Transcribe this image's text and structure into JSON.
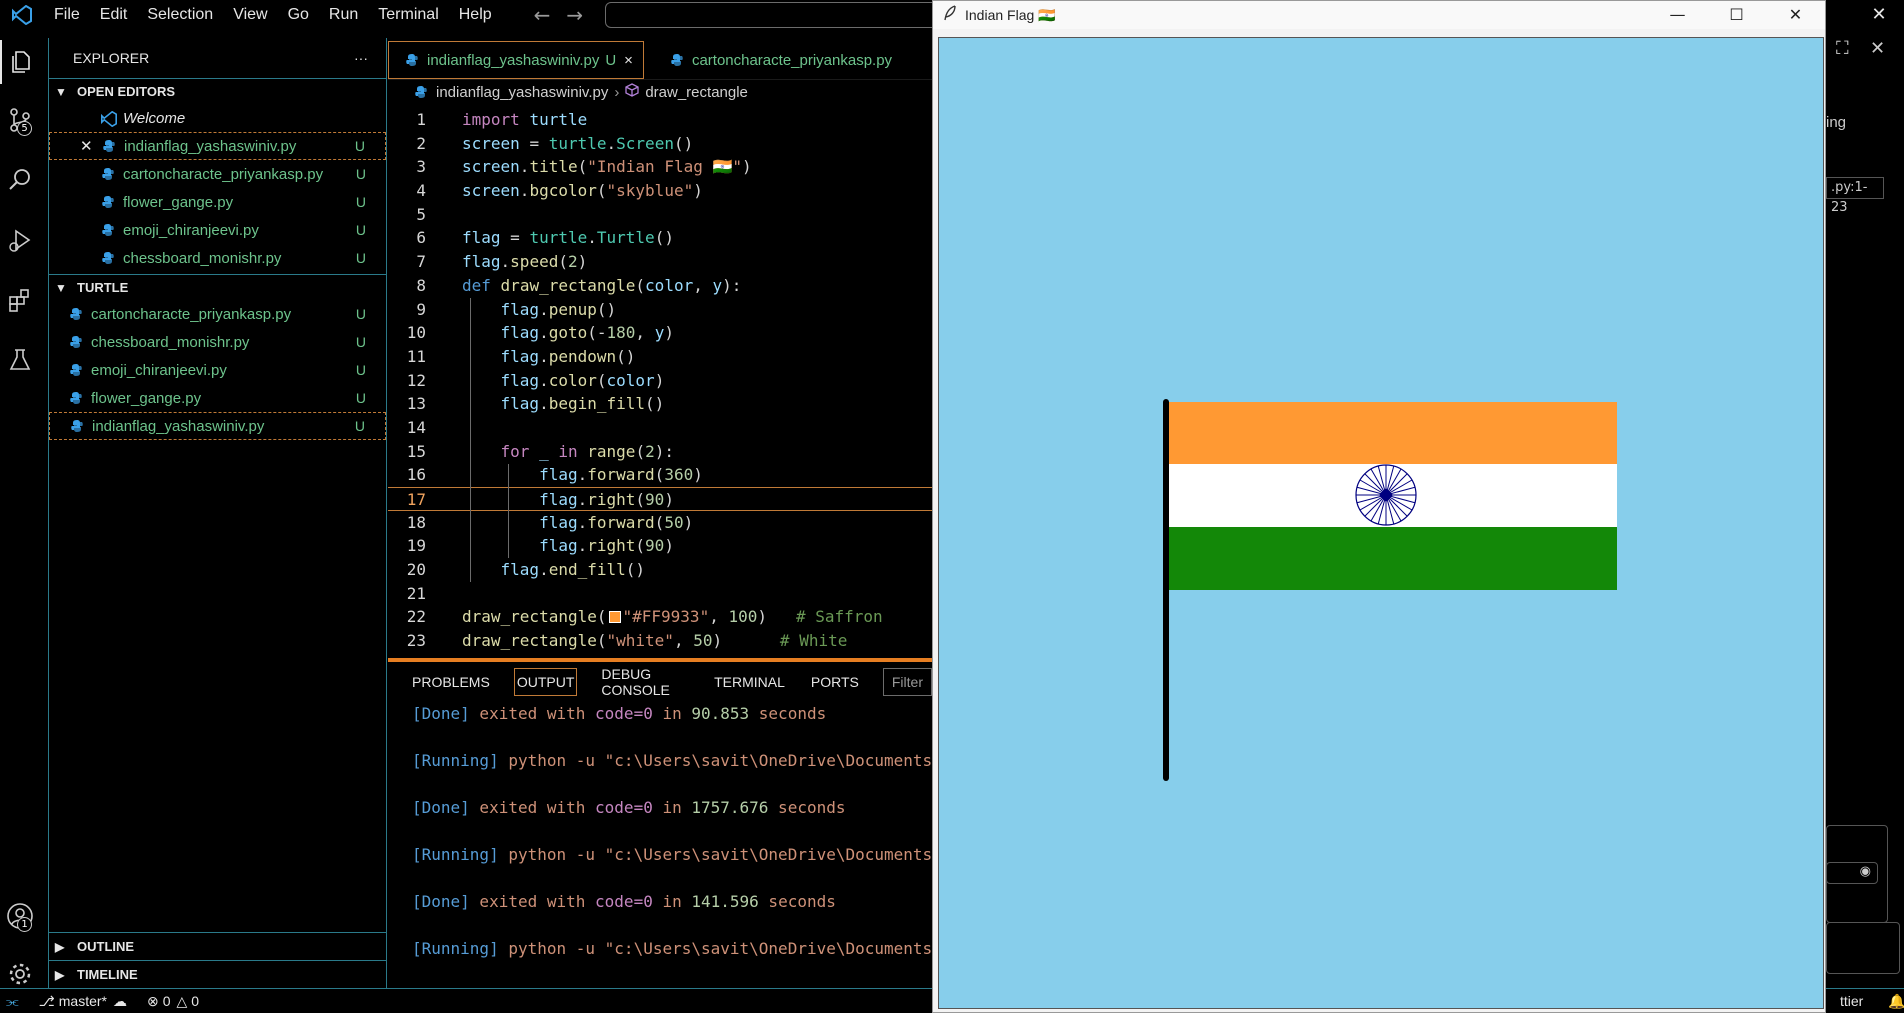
{
  "menubar": {
    "items": [
      "File",
      "Edit",
      "Selection",
      "View",
      "Go",
      "Run",
      "Terminal",
      "Help"
    ],
    "back_icon": "arrow-left-icon",
    "forward_icon": "arrow-right-icon"
  },
  "activity": {
    "source_control_badge": "5",
    "accounts_badge": "1"
  },
  "explorer": {
    "title": "EXPLORER",
    "more": "···",
    "open_editors_label": "OPEN EDITORS",
    "open_editors": [
      {
        "name": "Welcome",
        "status": ""
      },
      {
        "name": "indianflag_yashaswiniv.py",
        "status": "U"
      },
      {
        "name": "cartoncharacte_priyankasp.py",
        "status": "U"
      },
      {
        "name": "flower_gange.py",
        "status": "U"
      },
      {
        "name": "emoji_chiranjeevi.py",
        "status": "U"
      },
      {
        "name": "chessboard_monishr.py",
        "status": "U"
      }
    ],
    "folder_label": "TURTLE",
    "files": [
      {
        "name": "cartoncharacte_priyankasp.py",
        "status": "U"
      },
      {
        "name": "chessboard_monishr.py",
        "status": "U"
      },
      {
        "name": "emoji_chiranjeevi.py",
        "status": "U"
      },
      {
        "name": "flower_gange.py",
        "status": "U"
      },
      {
        "name": "indianflag_yashaswiniv.py",
        "status": "U"
      }
    ],
    "outline_label": "OUTLINE",
    "timeline_label": "TIMELINE"
  },
  "editor": {
    "tabs": [
      {
        "name": "indianflag_yashaswiniv.py",
        "status": "U",
        "close": "×"
      },
      {
        "name": "cartoncharacte_priyankasp.py",
        "status": ""
      }
    ],
    "breadcrumb": {
      "file": "indianflag_yashaswiniv.py",
      "symbol": "draw_rectangle"
    },
    "line_numbers": [
      "1",
      "2",
      "3",
      "4",
      "5",
      "6",
      "7",
      "8",
      "9",
      "10",
      "11",
      "12",
      "13",
      "14",
      "15",
      "16",
      "17",
      "18",
      "19",
      "20",
      "21",
      "22",
      "23"
    ],
    "current_line": 17,
    "code": [
      "import turtle",
      "screen = turtle.Screen()",
      "screen.title(\"Indian Flag 🇮🇳\")",
      "screen.bgcolor(\"skyblue\")",
      "",
      "flag = turtle.Turtle()",
      "flag.speed(2)",
      "def draw_rectangle(color, y):",
      "    flag.penup()",
      "    flag.goto(-180, y)",
      "    flag.pendown()",
      "    flag.color(color)",
      "    flag.begin_fill()",
      "",
      "    for _ in range(2):",
      "        flag.forward(360)",
      "        flag.right(90)",
      "        flag.forward(50)",
      "        flag.right(90)",
      "    flag.end_fill()",
      "",
      "draw_rectangle(\"#FF9933\", 100)   # Saffron",
      "draw_rectangle(\"white\", 50)      # White"
    ]
  },
  "panel": {
    "tabs": [
      "PROBLEMS",
      "OUTPUT",
      "DEBUG CONSOLE",
      "TERMINAL",
      "PORTS"
    ],
    "active_tab": "OUTPUT",
    "filter_placeholder": "Filter",
    "lines": [
      {
        "tag": "[Done]",
        "text": " exited with ",
        "code": "code=0",
        "in": " in ",
        "secs": "90.853",
        "unit": " seconds"
      },
      {
        "tag": "[Running]",
        "cmd": " python -u \"c:\\Users\\savit\\OneDrive\\Documents"
      },
      {
        "tag": "[Done]",
        "text": " exited with ",
        "code": "code=0",
        "in": " in ",
        "secs": "1757.676",
        "unit": " seconds"
      },
      {
        "tag": "[Running]",
        "cmd": " python -u \"c:\\Users\\savit\\OneDrive\\Documents"
      },
      {
        "tag": "[Done]",
        "text": " exited with ",
        "code": "code=0",
        "in": " in ",
        "secs": "141.596",
        "unit": " seconds"
      },
      {
        "tag": "[Running]",
        "cmd": " python -u \"c:\\Users\\savit\\OneDrive\\Documents"
      }
    ]
  },
  "statusbar": {
    "branch": "master*",
    "errors": "0",
    "warnings": "0",
    "right_text": "ttier"
  },
  "right_panel": {
    "text1": "ing",
    "chip": ".py:1-23"
  },
  "turtle_window": {
    "title": "Indian Flag 🇮🇳",
    "background": "#87ceeb",
    "saffron": "#FF9933",
    "white": "#ffffff",
    "green": "#138808",
    "chakra": "#000080",
    "pole": "#000000",
    "chakra_spokes": 24
  }
}
